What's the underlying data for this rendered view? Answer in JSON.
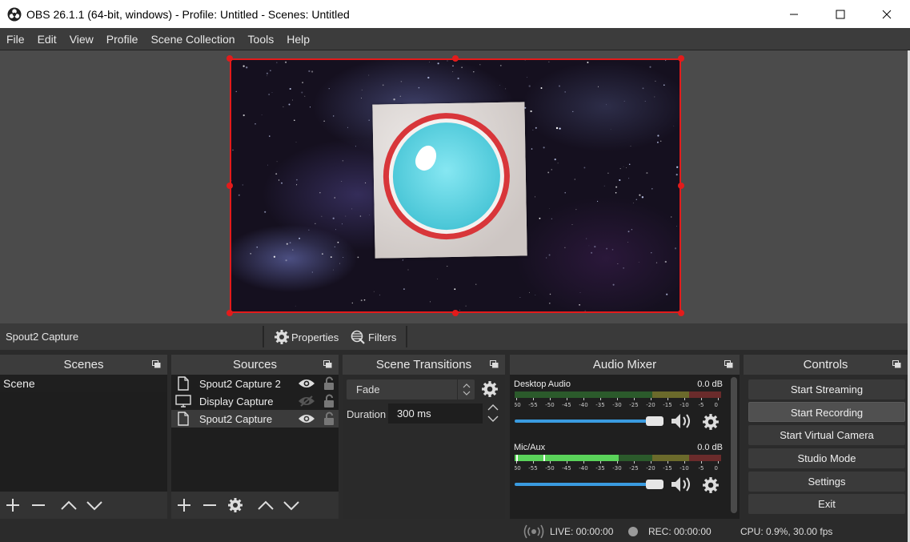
{
  "window": {
    "title": "OBS 26.1.1 (64-bit, windows) - Profile: Untitled - Scenes: Untitled"
  },
  "menu": [
    "File",
    "Edit",
    "View",
    "Profile",
    "Scene Collection",
    "Tools",
    "Help"
  ],
  "source_toolbar": {
    "selected_source": "Spout2 Capture",
    "properties_label": "Properties",
    "filters_label": "Filters"
  },
  "scenes": {
    "title": "Scenes",
    "items": [
      "Scene"
    ]
  },
  "sources": {
    "title": "Sources",
    "items": [
      {
        "label": "Spout2 Capture 2",
        "icon": "document-icon",
        "visible": true
      },
      {
        "label": "Display Capture",
        "icon": "monitor-icon",
        "visible": false
      },
      {
        "label": "Spout2 Capture",
        "icon": "document-icon",
        "visible": true
      }
    ]
  },
  "transitions": {
    "title": "Scene Transitions",
    "selected": "Fade",
    "duration_label": "Duration",
    "duration_value": "300 ms"
  },
  "mixer": {
    "title": "Audio Mixer",
    "channels": [
      {
        "name": "Desktop Audio",
        "db": "0.0 dB",
        "volume": 1.0
      },
      {
        "name": "Mic/Aux",
        "db": "0.0 dB",
        "volume": 1.0
      }
    ],
    "scale": [
      "-60",
      "-55",
      "-50",
      "-45",
      "-40",
      "-35",
      "-30",
      "-25",
      "-20",
      "-15",
      "-10",
      "-5",
      "0"
    ]
  },
  "controls": {
    "title": "Controls",
    "buttons": [
      "Start Streaming",
      "Start Recording",
      "Start Virtual Camera",
      "Studio Mode",
      "Settings",
      "Exit"
    ]
  },
  "status": {
    "live": "LIVE: 00:00:00",
    "rec": "REC: 00:00:00",
    "cpu": "CPU: 0.9%, 30.00 fps"
  },
  "colors": {
    "accent_red": "#e31b1b",
    "panel_bg": "#2a2a2a",
    "volume_blue": "#3a9be0"
  }
}
